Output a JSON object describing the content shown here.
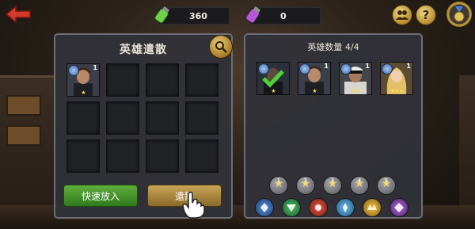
{
  "resources": {
    "green_value": "360",
    "purple_value": "0"
  },
  "top_icons": {
    "help_label": "?"
  },
  "left_panel": {
    "title": "英雄遣散",
    "hero": {
      "level": "1",
      "stars": "★"
    },
    "buttons": {
      "quick_add": "快速放入",
      "dismiss": "遣散"
    }
  },
  "right_panel": {
    "title": "英雄数量 4/4",
    "heroes": [
      {
        "level": "",
        "stars": "★",
        "selected": true
      },
      {
        "level": "1",
        "stars": "★",
        "selected": false
      },
      {
        "level": "1",
        "stars": "★★",
        "selected": false
      },
      {
        "level": "1",
        "stars": "★★★",
        "selected": false
      }
    ],
    "star_filters": [
      "1",
      "2",
      "3",
      "4",
      "5"
    ],
    "class_filters": [
      "blue",
      "green",
      "red",
      "sky",
      "gold",
      "purple"
    ]
  },
  "colors": {
    "accent_gold": "#c9a556",
    "accent_green": "#3f8f2a",
    "star": "#ffd84a"
  }
}
